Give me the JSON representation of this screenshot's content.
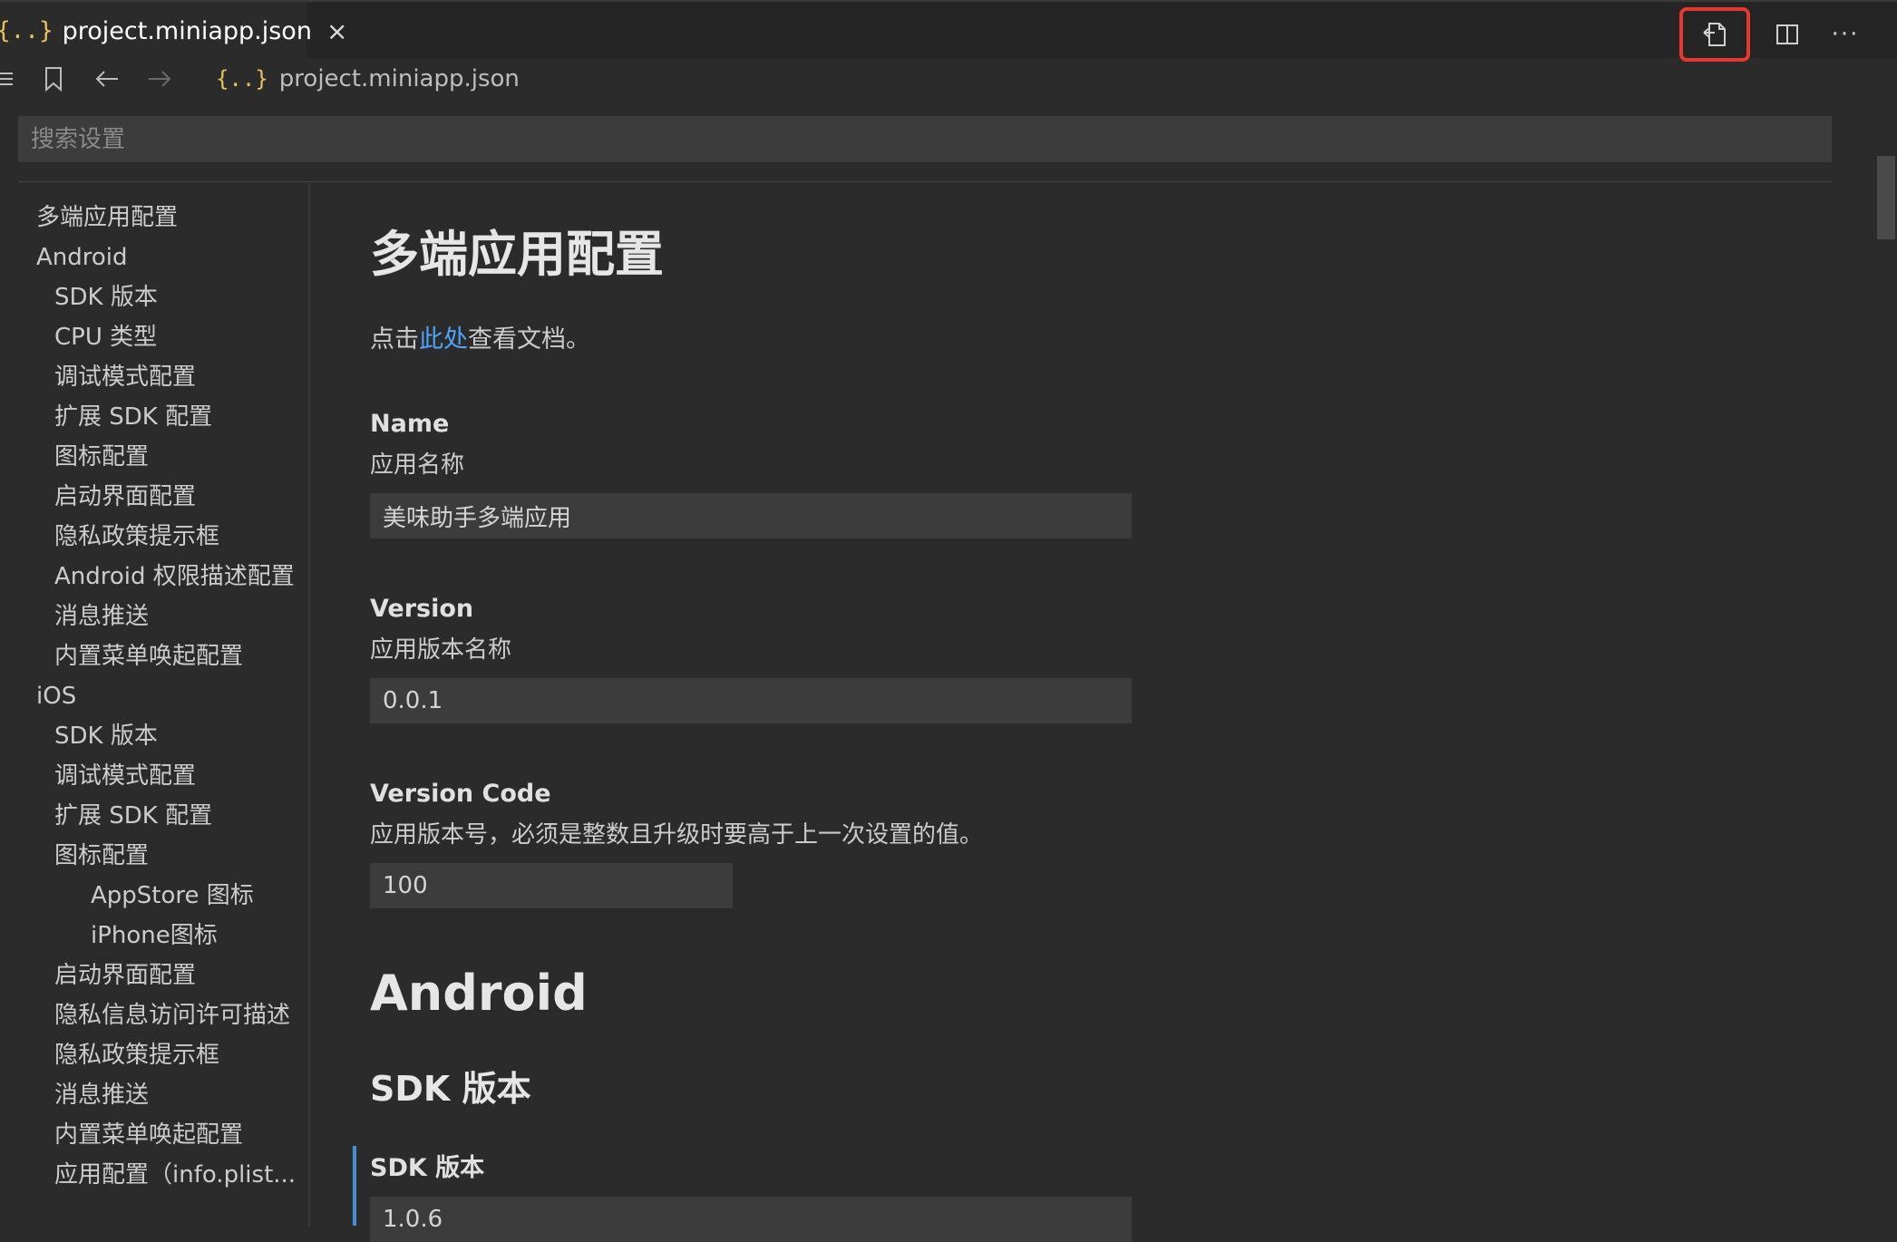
{
  "tab": {
    "icon": "{..}",
    "title": "project.miniapp.json",
    "close": "×"
  },
  "actions": [
    {
      "name": "open-json-icon"
    },
    {
      "name": "split-editor-icon"
    },
    {
      "name": "more-actions-icon",
      "label": "···"
    }
  ],
  "breadcrumb": {
    "json_icon": "{..}",
    "file": "project.miniapp.json"
  },
  "search": {
    "placeholder": "搜索设置"
  },
  "toc": [
    {
      "label": "多端应用配置",
      "level": 0
    },
    {
      "label": "Android",
      "level": 0
    },
    {
      "label": "SDK 版本",
      "level": 1
    },
    {
      "label": "CPU 类型",
      "level": 1
    },
    {
      "label": "调试模式配置",
      "level": 1
    },
    {
      "label": "扩展 SDK 配置",
      "level": 1
    },
    {
      "label": "图标配置",
      "level": 1
    },
    {
      "label": "启动界面配置",
      "level": 1
    },
    {
      "label": "隐私政策提示框",
      "level": 1
    },
    {
      "label": "Android 权限描述配置",
      "level": 1
    },
    {
      "label": "消息推送",
      "level": 1
    },
    {
      "label": "内置菜单唤起配置",
      "level": 1
    },
    {
      "label": "iOS",
      "level": 0
    },
    {
      "label": "SDK 版本",
      "level": 1
    },
    {
      "label": "调试模式配置",
      "level": 1
    },
    {
      "label": "扩展 SDK 配置",
      "level": 1
    },
    {
      "label": "图标配置",
      "level": 1
    },
    {
      "label": "AppStore 图标",
      "level": 2
    },
    {
      "label": "iPhone图标",
      "level": 2
    },
    {
      "label": "启动界面配置",
      "level": 1
    },
    {
      "label": "隐私信息访问许可描述",
      "level": 1
    },
    {
      "label": "隐私政策提示框",
      "level": 1
    },
    {
      "label": "消息推送",
      "level": 1
    },
    {
      "label": "内置菜单唤起配置",
      "level": 1
    },
    {
      "label": "应用配置（info.plist...",
      "level": 1
    }
  ],
  "main": {
    "title": "多端应用配置",
    "doc_prefix": "点击",
    "doc_link": "此处",
    "doc_suffix": "查看文档。",
    "fields": [
      {
        "title": "Name",
        "desc": "应用名称",
        "value": "美味助手多端应用"
      },
      {
        "title": "Version",
        "desc": "应用版本名称",
        "value": "0.0.1"
      },
      {
        "title": "Version Code",
        "desc": "应用版本号，必须是整数且升级时要高于上一次设置的值。",
        "value": "100"
      }
    ],
    "section_android": "Android",
    "subsection_sdk": "SDK 版本",
    "sdk_field": {
      "title": "SDK 版本",
      "value": "1.0.6"
    }
  },
  "colors": {
    "link": "#4fa3f7",
    "json_icon": "#e8c35a",
    "highlight": "#e5392f",
    "focus": "#4a8dd6"
  }
}
